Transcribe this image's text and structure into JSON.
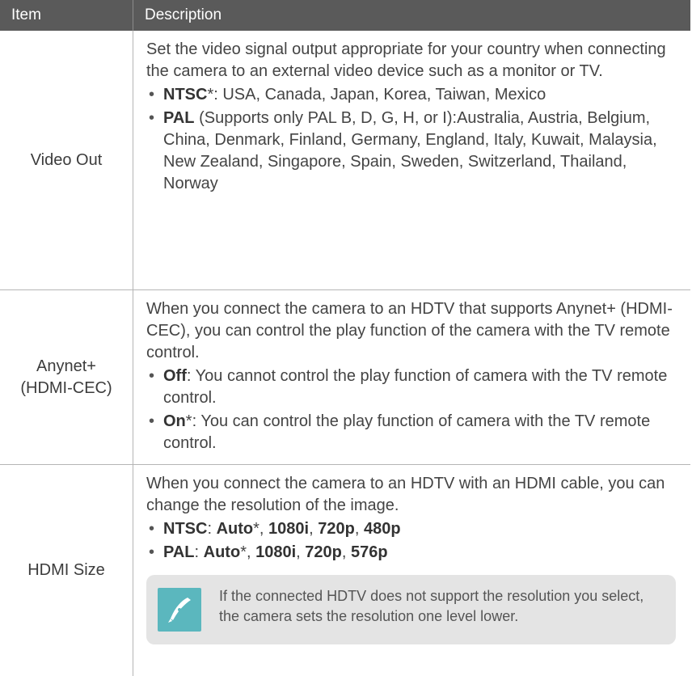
{
  "header": {
    "item": "Item",
    "description": "Description"
  },
  "rows": [
    {
      "item": "Video Out",
      "intro": "Set the video signal output appropriate for your country when connecting the camera to an external video device such as a monitor or TV.",
      "bullets": [
        {
          "term": "NTSC",
          "mark": "*",
          "text": ": USA, Canada, Japan, Korea, Taiwan, Mexico"
        },
        {
          "term": "PAL",
          "mark": "",
          "text": " (Supports only PAL B, D, G, H, or I):Australia, Austria, Belgium, China, Denmark, Finland, Germany, England, Italy, Kuwait, Malaysia, New Zealand, Singapore, Spain, Sweden, Switzerland, Thailand, Norway"
        }
      ]
    },
    {
      "item_line1": "Anynet+",
      "item_line2": "(HDMI-CEC)",
      "intro": "When you connect the camera to an HDTV that supports Anynet+ (HDMI-CEC), you can control the play function of the camera with the TV remote control.",
      "bullets": [
        {
          "term": "Off",
          "mark": "",
          "text": ": You cannot control the play function of camera with the TV remote control."
        },
        {
          "term": "On",
          "mark": "*",
          "text": ": You can control the play function of camera with the TV remote control."
        }
      ]
    },
    {
      "item": "HDMI Size",
      "intro": "When you connect the camera to an HDTV with an HDMI cable, you can change the resolution of the image.",
      "ntsc": {
        "term": "NTSC",
        "sep": ": ",
        "auto": "Auto",
        "mark": "*",
        "v1": "1080i",
        "v2": "720p",
        "v3": "480p"
      },
      "pal": {
        "term": "PAL",
        "sep": ": ",
        "auto": "Auto",
        "mark": "*",
        "v1": "1080i",
        "v2": "720p",
        "v3": "576p"
      },
      "note": "If the connected HDTV does not support the resolution you select, the camera sets the resolution one level lower.",
      "note_icon": "pen-note-icon"
    }
  ],
  "colors": {
    "header_bg": "#5a5a5a",
    "note_bg": "#e4e4e4",
    "note_icon": "#5bb7be"
  }
}
